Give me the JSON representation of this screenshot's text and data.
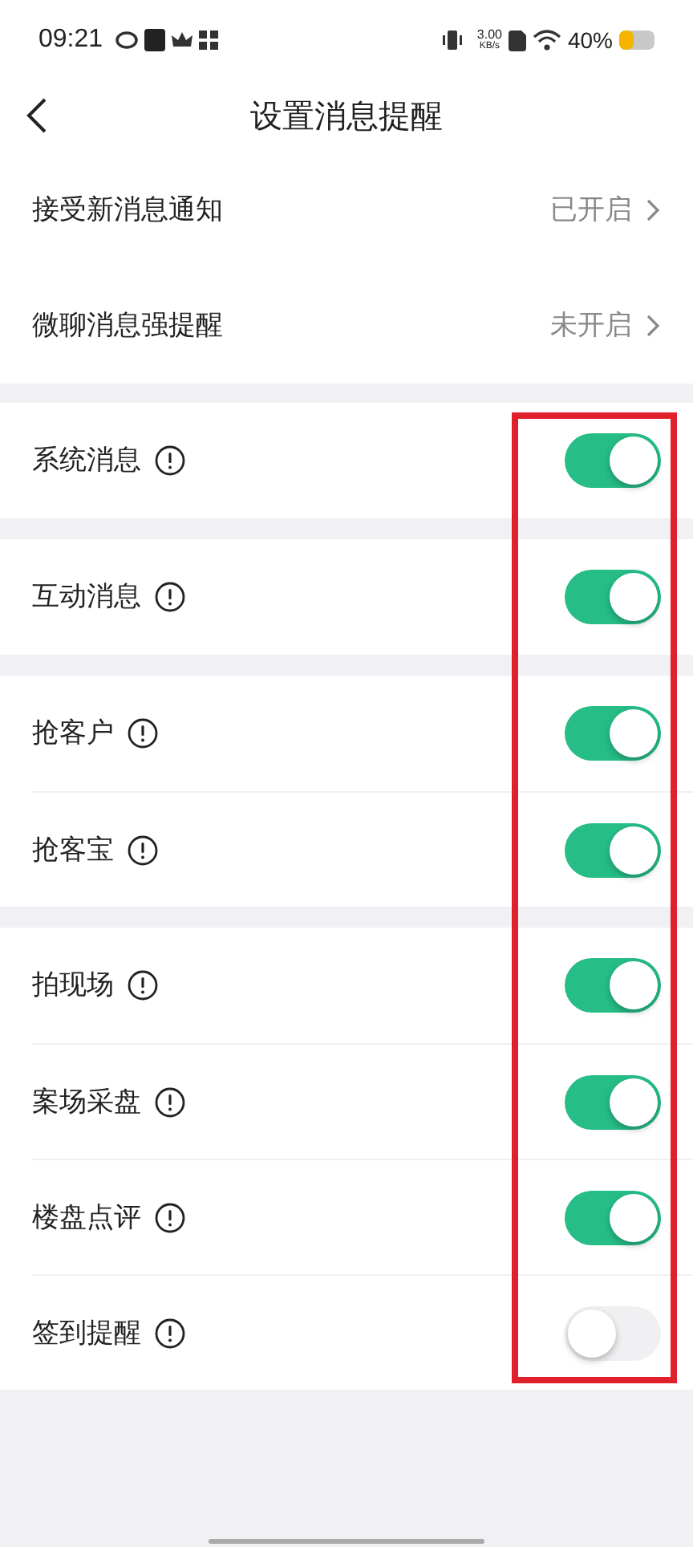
{
  "status_bar": {
    "time": "09:21",
    "speed": "3.00",
    "speed_unit": "KB/s",
    "battery": "40%"
  },
  "header": {
    "title": "设置消息提醒"
  },
  "nav_rows": [
    {
      "label": "接受新消息通知",
      "value": "已开启"
    },
    {
      "label": "微聊消息强提醒",
      "value": "未开启"
    }
  ],
  "groups": [
    [
      {
        "label": "系统消息",
        "on": true
      }
    ],
    [
      {
        "label": "互动消息",
        "on": true
      }
    ],
    [
      {
        "label": "抢客户",
        "on": true
      },
      {
        "label": "抢客宝",
        "on": true
      }
    ],
    [
      {
        "label": "拍现场",
        "on": true
      },
      {
        "label": "案场采盘",
        "on": true
      },
      {
        "label": "楼盘点评",
        "on": true
      },
      {
        "label": "签到提醒",
        "on": false
      }
    ]
  ]
}
